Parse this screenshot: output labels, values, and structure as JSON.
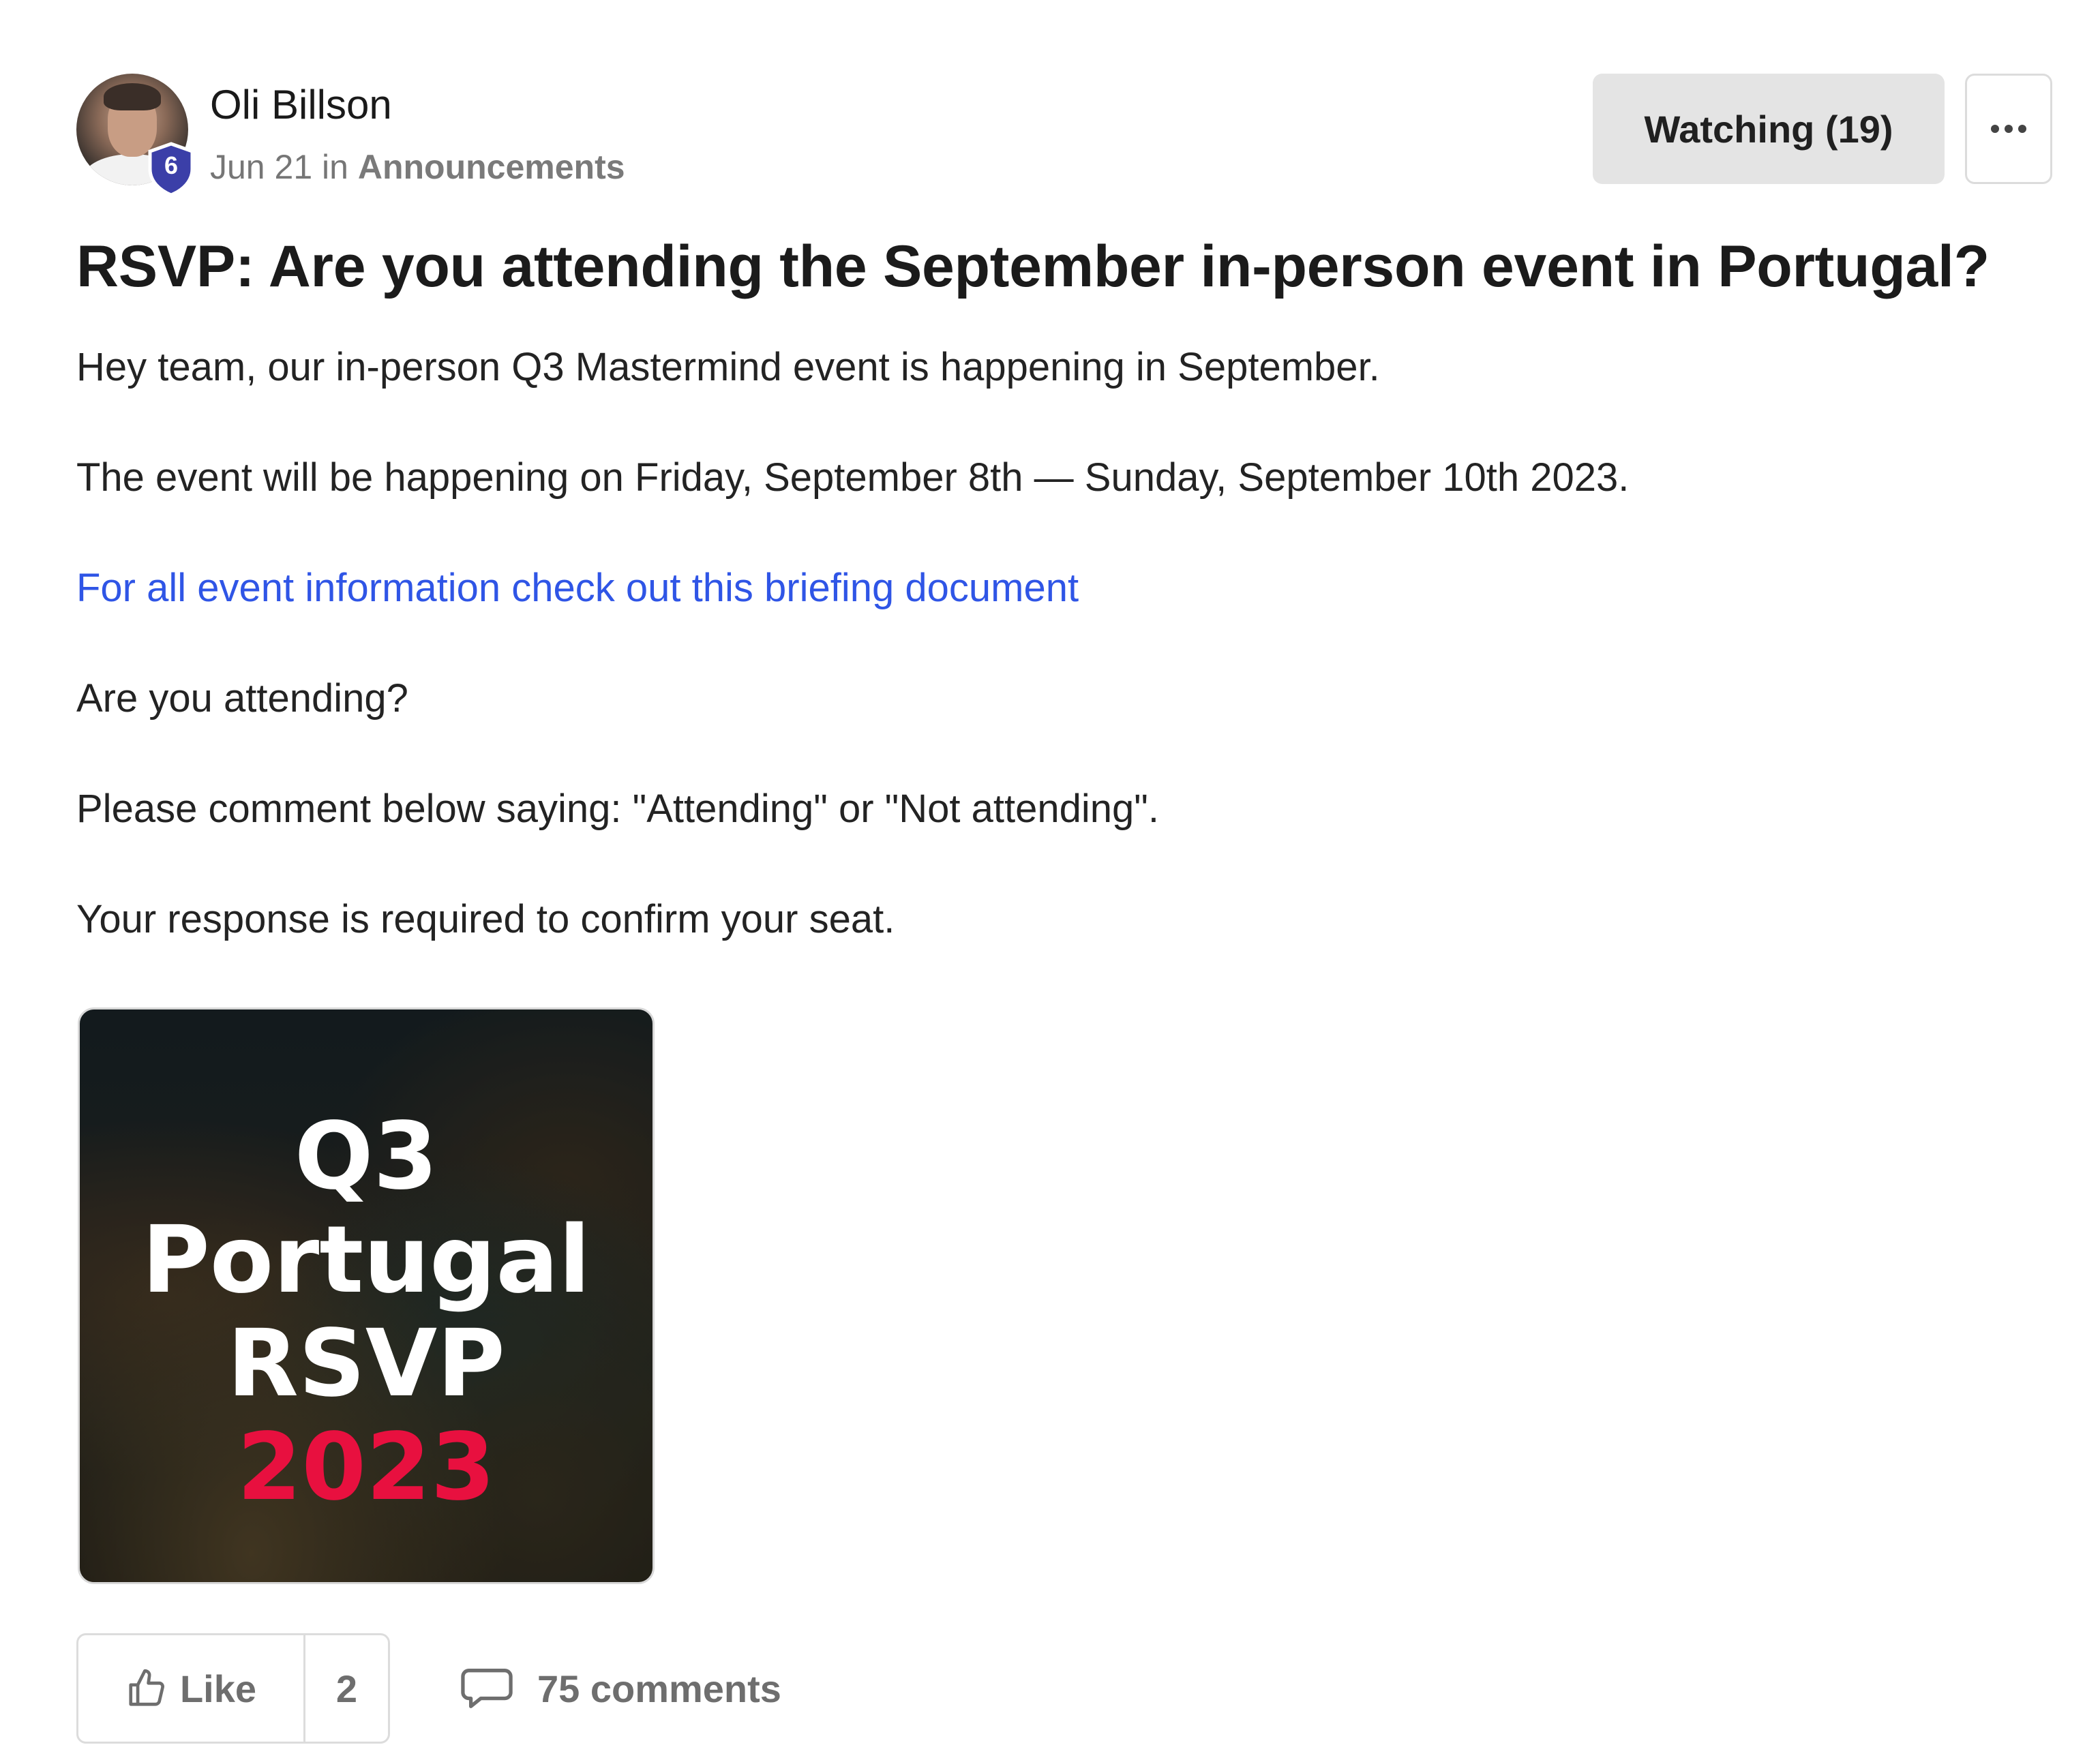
{
  "author": {
    "name": "Oli Billson",
    "level": "6"
  },
  "meta": {
    "date": "Jun 21",
    "in_word": "in",
    "category": "Announcements"
  },
  "header_actions": {
    "watching_label": "Watching (19)"
  },
  "post": {
    "title": "RSVP: Are you attending the September in-person event in Portugal?",
    "paragraphs": [
      "Hey team, our in-person Q3 Mastermind event is happening in September.",
      "The event will be happening on Friday, September 8th — Sunday, September 10th 2023."
    ],
    "link_text": "For all event information check out this briefing document",
    "paragraphs_after": [
      "Are you attending?",
      "Please comment below saying: \"Attending\" or \"Not attending\".",
      "Your response is required to confirm your seat."
    ]
  },
  "image": {
    "line1": "Q3",
    "line2": "Portugal",
    "line3": "RSVP",
    "line4": "2023"
  },
  "footer": {
    "like_label": "Like",
    "like_count": "2",
    "comments_label": "75 comments"
  },
  "colors": {
    "link": "#2f55e6",
    "badge": "#3b3fa8",
    "watch_button_bg": "#e4e4e4",
    "image_accent": "#e8103f"
  },
  "icons": {
    "like": "thumbs-up-icon",
    "comments": "speech-bubble-icon",
    "more": "ellipsis-icon",
    "level": "shield-icon"
  }
}
